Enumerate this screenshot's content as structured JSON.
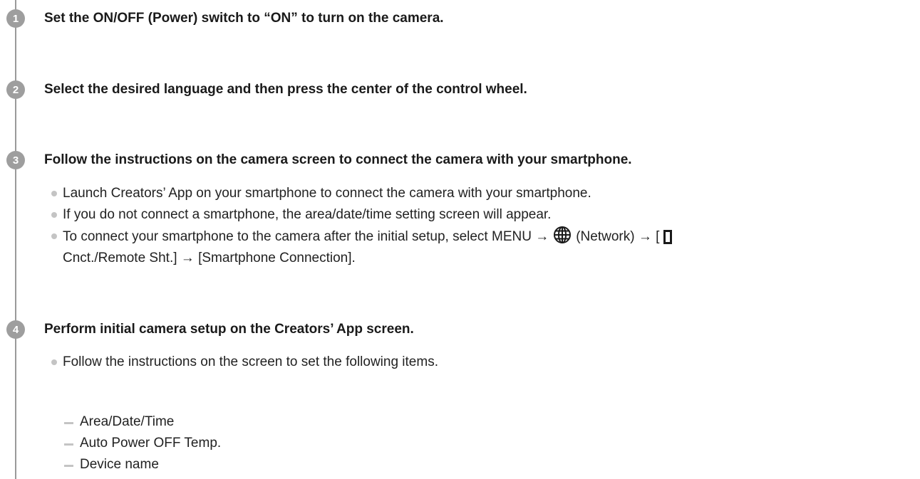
{
  "steps": [
    {
      "number": "1",
      "title": "Set the ON/OFF (Power) switch to “ON” to turn on the camera."
    },
    {
      "number": "2",
      "title": "Select the desired language and then press the center of the control wheel."
    },
    {
      "number": "3",
      "title": "Follow the instructions on the camera screen to connect the camera with your smartphone.",
      "bullets": [
        "Launch Creators’ App on your smartphone to connect the camera with your smartphone.",
        "If you do not connect a smartphone, the area/date/time setting screen will appear."
      ],
      "bullet3": {
        "part1": "To connect your smartphone to the camera after the initial setup, select MENU →",
        "part2": "(Network) → [",
        "line2": "Cnct./Remote Sht.] → [Smartphone Connection]."
      }
    },
    {
      "number": "4",
      "title": "Perform initial camera setup on the Creators’ App screen.",
      "bullets": [
        "Follow the instructions on the screen to set the following items."
      ],
      "subitems": [
        "Area/Date/Time",
        "Auto Power OFF Temp.",
        "Device name"
      ]
    }
  ],
  "icons": {
    "network": "globe-icon",
    "remote": "smartphone-frame-icon"
  },
  "colors": {
    "badge": "#9e9e9e",
    "bullet": "#c4c4c4",
    "text": "#1a1a1a"
  }
}
